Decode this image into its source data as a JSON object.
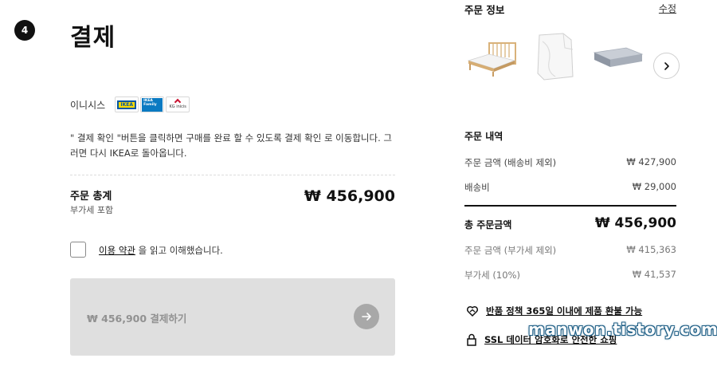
{
  "payment": {
    "step_number": "4",
    "title": "결제",
    "provider_label": "이니시스",
    "logos": {
      "ikea": "IKEA",
      "family": "IKEA Family",
      "kg": "KG inicis"
    },
    "instruction": "\" 결제 확인 \"버튼을 클릭하면 구매를 완료 할 수 있도록 결제 확인 로 이동합니다. 그러면 다시 IKEA로 돌아옵니다.",
    "total_label": "주문 총계",
    "total_sub": "부가세 포함",
    "total_amount": "₩ 456,900",
    "agree_link": "이용 약관",
    "agree_suffix": " 을 읽고 이해했습니다.",
    "pay_button_label": "₩ 456,900 결제하기",
    "pay_button_icon": "arrow-right-icon"
  },
  "order_info": {
    "title": "주문 정보",
    "edit_label": "수정",
    "thumbnails": [
      "bed-frame-thumbnail",
      "fitted-sheet-thumbnail",
      "mattress-thumbnail"
    ],
    "next_icon": "chevron-right-icon"
  },
  "summary": {
    "title": "주문 내역",
    "rows": [
      {
        "label": "주문 금액 (배송비 제외)",
        "value": "₩ 427,900"
      },
      {
        "label": "배송비",
        "value": "₩ 29,000"
      }
    ],
    "grand_label": "총 주문금액",
    "grand_value": "₩ 456,900",
    "tax_rows": [
      {
        "label": "주문 금액 (부가세 제외)",
        "value": "₩ 415,363"
      },
      {
        "label": "부가세 (10%)",
        "value": "₩ 41,537"
      }
    ]
  },
  "features": [
    {
      "icon": "heart-hands-icon",
      "text": "반품 정책 365일 이내에 제품 환불 가능"
    },
    {
      "icon": "lock-icon",
      "text": "SSL 데이터 암호화로 안전한 쇼핑"
    }
  ],
  "watermark": "manwon.tistory.com",
  "colors": {
    "primary_text": "#111111",
    "button_disabled_bg": "#dfdfdf",
    "button_disabled_text": "#919191",
    "watermark_outline": "#1f5f86"
  }
}
